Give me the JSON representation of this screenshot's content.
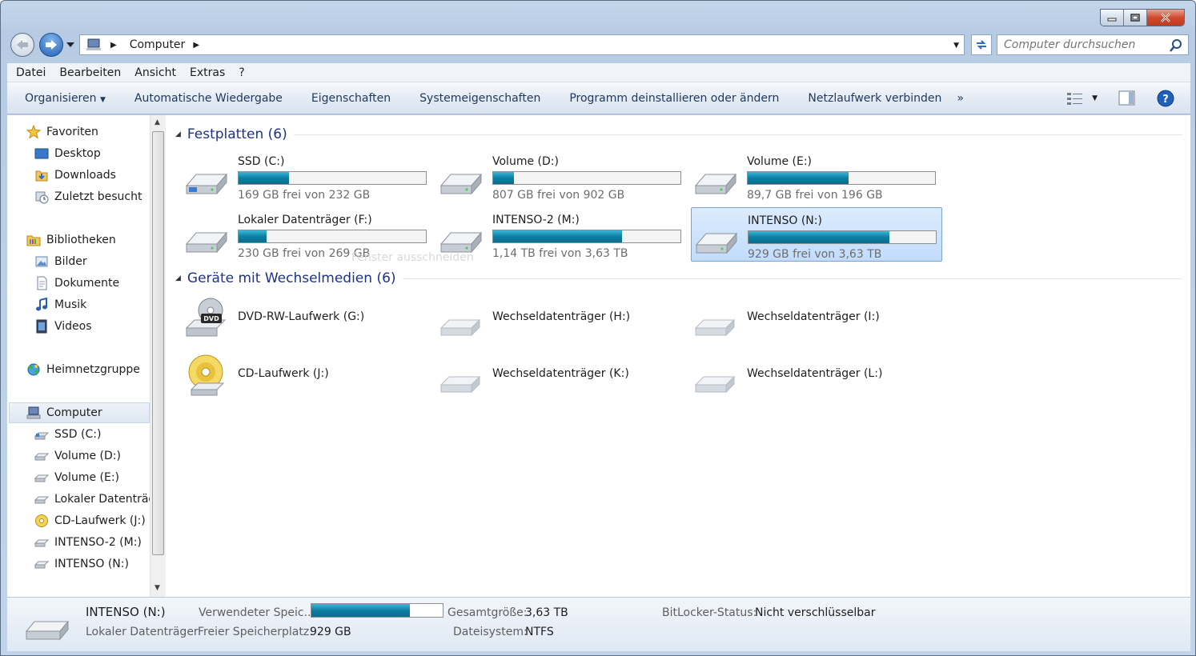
{
  "window": {
    "title_buttons": [
      "minimize",
      "maximize",
      "close"
    ]
  },
  "address": {
    "path": "Computer",
    "search_placeholder": "Computer durchsuchen"
  },
  "menu": [
    "Datei",
    "Bearbeiten",
    "Ansicht",
    "Extras",
    "?"
  ],
  "commands": [
    "Organisieren",
    "Automatische Wiedergabe",
    "Eigenschaften",
    "Systemeigenschaften",
    "Programm deinstallieren oder ändern",
    "Netzlaufwerk verbinden"
  ],
  "commands_more": "»",
  "sidebar": {
    "favorites": {
      "label": "Favoriten",
      "items": [
        "Desktop",
        "Downloads",
        "Zuletzt besucht"
      ]
    },
    "libraries": {
      "label": "Bibliotheken",
      "items": [
        "Bilder",
        "Dokumente",
        "Musik",
        "Videos"
      ]
    },
    "homegroup": {
      "label": "Heimnetzgruppe"
    },
    "computer": {
      "label": "Computer",
      "items": [
        "SSD (C:)",
        "Volume (D:)",
        "Volume (E:)",
        "Lokaler Datenträger (F:)",
        "CD-Laufwerk (J:)",
        "INTENSO-2 (M:)",
        "INTENSO (N:)"
      ]
    }
  },
  "hard_drives": {
    "title": "Festplatten (6)",
    "items": [
      {
        "name": "SSD (C:)",
        "free_text": "169 GB frei von 232 GB",
        "used_fraction": 0.27
      },
      {
        "name": "Volume (D:)",
        "free_text": "807 GB frei von 902 GB",
        "used_fraction": 0.11
      },
      {
        "name": "Volume (E:)",
        "free_text": "89,7 GB frei von 196 GB",
        "used_fraction": 0.54
      },
      {
        "name": "Lokaler Datenträger (F:)",
        "free_text": "230 GB frei von 269 GB",
        "used_fraction": 0.15
      },
      {
        "name": "INTENSO-2 (M:)",
        "free_text": "1,14 TB frei von 3,63 TB",
        "used_fraction": 0.69
      },
      {
        "name": "INTENSO (N:)",
        "free_text": "929 GB frei von 3,63 TB",
        "used_fraction": 0.75
      }
    ]
  },
  "removable": {
    "title": "Geräte mit Wechselmedien (6)",
    "items": [
      "DVD-RW-Laufwerk (G:)",
      "Wechseldatenträger (H:)",
      "Wechseldatenträger (I:)",
      "CD-Laufwerk (J:)",
      "Wechseldatenträger (K:)",
      "Wechseldatenträger (L:)"
    ]
  },
  "ghost_text": "Fenster ausschneiden",
  "details": {
    "name": "INTENSO (N:)",
    "type": "Lokaler Datenträger",
    "used_label": "Verwendeter Speic...",
    "used_fraction": 0.75,
    "free_label": "Freier Speicherplatz:",
    "free_value": "929 GB",
    "total_label": "Gesamtgröße:",
    "total_value": "3,63 TB",
    "fs_label": "Dateisystem:",
    "fs_value": "NTFS",
    "bitlocker_label": "BitLocker-Status:",
    "bitlocker_value": "Nicht verschlüsselbar"
  },
  "colors": {
    "accent": "#1e3287",
    "bar": "#0c7ea3",
    "selection": "#cce4fc"
  }
}
